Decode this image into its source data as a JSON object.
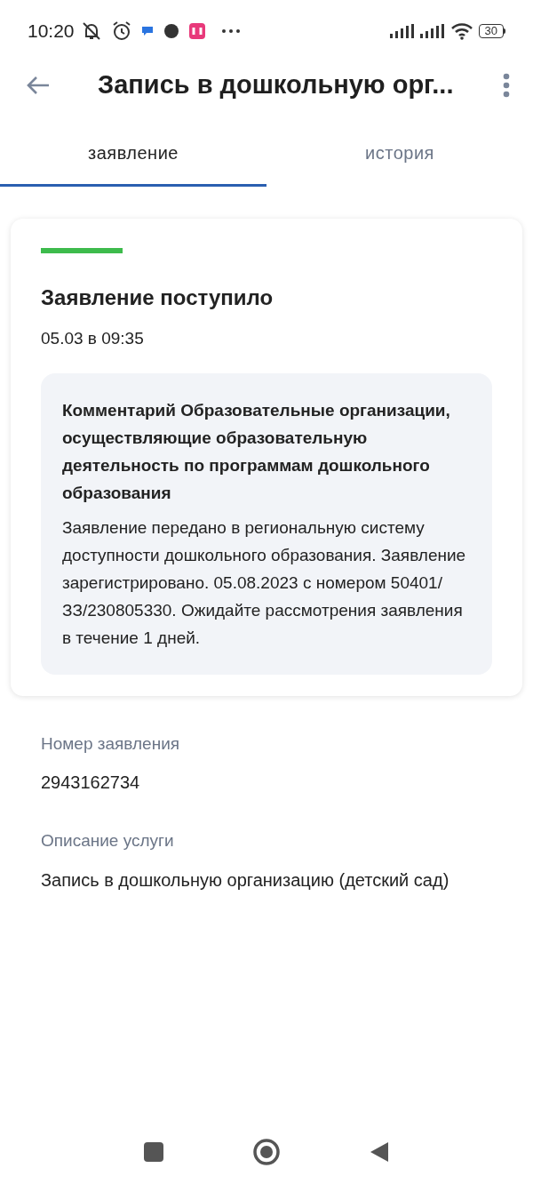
{
  "status_bar": {
    "time": "10:20",
    "battery": "30"
  },
  "app_bar": {
    "title": "Запись в дошкольную орг..."
  },
  "tabs": [
    {
      "label": "заявление",
      "selected": true
    },
    {
      "label": "история",
      "selected": false
    }
  ],
  "status_card": {
    "title": "Заявление поступило",
    "date": "05.03 в 09:35",
    "comment_title": "Комментарий Образовательные организации, осуществляющие образовательную деятельность по программам дошкольного образования",
    "comment_text": "Заявление передано в региональную систему доступности дошкольного образования. Заявление зарегистрировано. 05.08.2023 с номером 50401/ЗЗ/230805330. Ожидайте рассмотрения заявления в течение 1 дней."
  },
  "fields": [
    {
      "label": "Номер заявления",
      "value": "2943162734"
    },
    {
      "label": "Описание услуги",
      "value": "Запись в дошкольную организацию (детский сад)"
    }
  ]
}
